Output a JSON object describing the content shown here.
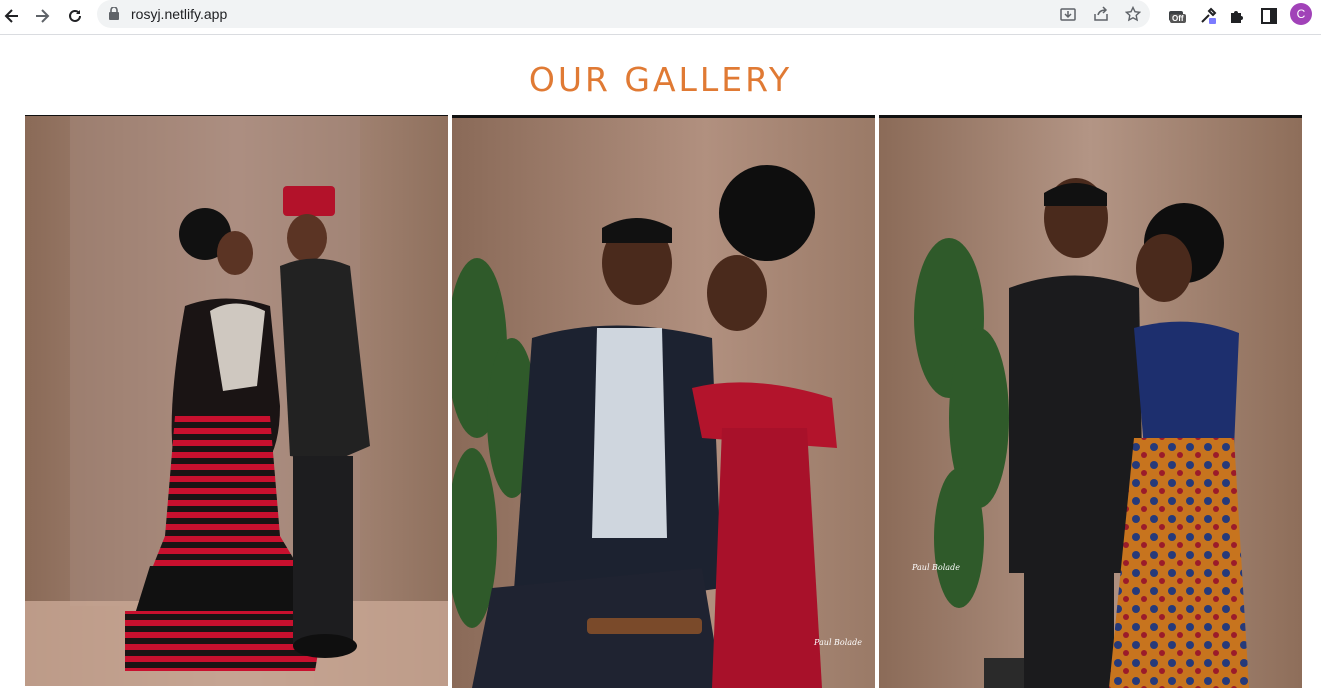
{
  "browser": {
    "url": "rosyj.netlify.app",
    "profile_initial": "C",
    "extension_badge": "Off",
    "icons": [
      "back-icon",
      "forward-icon",
      "reload-icon",
      "lock-icon",
      "install-icon",
      "share-icon",
      "bookmark-star-icon",
      "extension-icon",
      "eyedropper-icon",
      "puzzle-icon",
      "sidepanel-icon"
    ]
  },
  "page": {
    "title": "OUR GALLERY",
    "accent_color": "#e07a34"
  },
  "gallery": [
    {
      "photo": "couple in traditional attire, red-black striped dress"
    },
    {
      "photo": "couple seated, man in suit, woman in red dress",
      "credit": "Paul Bolade"
    },
    {
      "photo": "couple standing, man in black native, woman in ankara",
      "credit": "Paul Bolade"
    }
  ]
}
